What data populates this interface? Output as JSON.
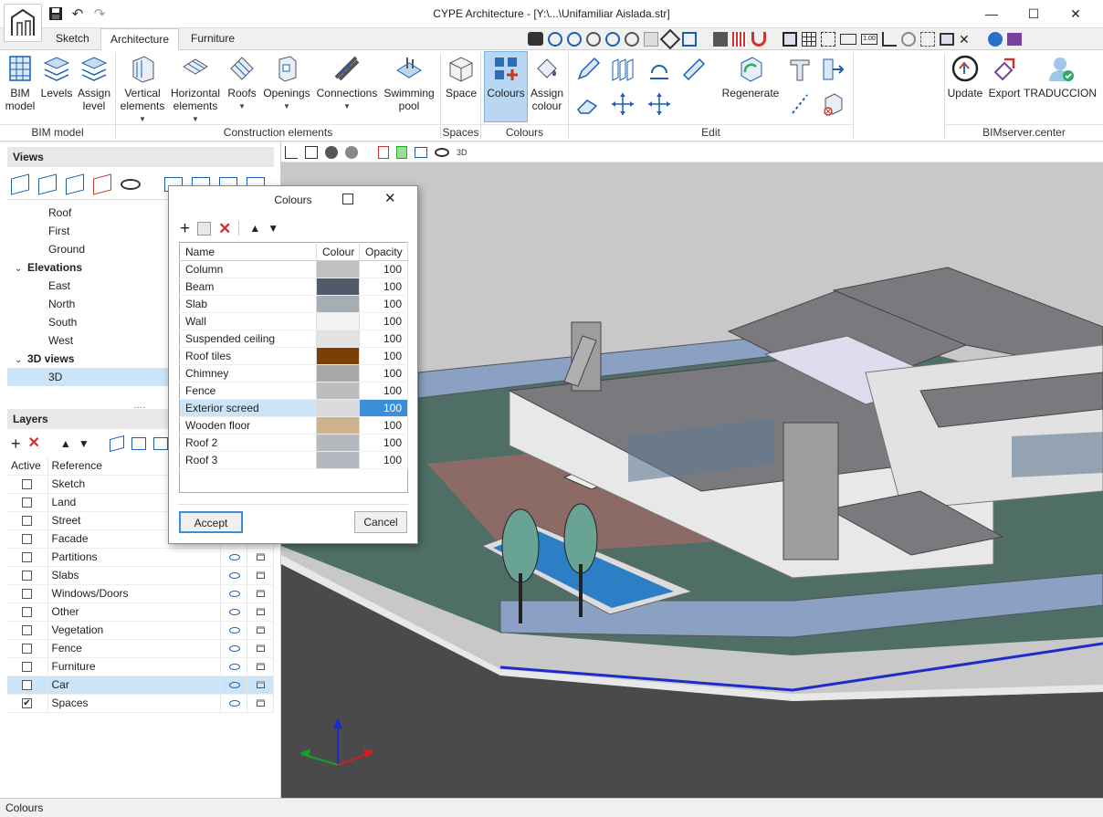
{
  "window": {
    "title": "CYPE Architecture - [Y:\\...\\Unifamiliar Aislada.str]",
    "minimize": "—",
    "maximize": "☐",
    "close": "✕"
  },
  "quick_access": {
    "save": "💾",
    "undo": "↶",
    "redo": "↷"
  },
  "tabs": [
    {
      "label": "Sketch"
    },
    {
      "label": "Architecture"
    },
    {
      "label": "Furniture"
    }
  ],
  "ribbon": {
    "bim_model": {
      "bim_model_label": "BIM model",
      "levels_label": "Levels",
      "assign_level_label": "Assign level",
      "group": "BIM model"
    },
    "construction": {
      "vertical_label": "Vertical elements",
      "horizontal_label": "Horizontal elements",
      "roofs_label": "Roofs",
      "openings_label": "Openings",
      "connections_label": "Connections",
      "pool_label": "Swimming pool",
      "group": "Construction elements"
    },
    "spaces": {
      "space_label": "Space",
      "group": "Spaces"
    },
    "colours": {
      "colours_label": "Colours",
      "assign_colour_label": "Assign colour",
      "group": "Colours"
    },
    "edit": {
      "regenerate_label": "Regenerate",
      "group": "Edit"
    },
    "bimserver": {
      "update_label": "Update",
      "export_label": "Export",
      "traduccion_label": "TRADUCCION",
      "group": "BIMserver.center"
    }
  },
  "views": {
    "header": "Views",
    "items": [
      {
        "label": "Roof",
        "indent": 2
      },
      {
        "label": "First",
        "indent": 2
      },
      {
        "label": "Ground",
        "indent": 2
      },
      {
        "label": "Elevations",
        "indent": 1,
        "expanded": true
      },
      {
        "label": "East",
        "indent": 2
      },
      {
        "label": "North",
        "indent": 2
      },
      {
        "label": "South",
        "indent": 2
      },
      {
        "label": "West",
        "indent": 2
      },
      {
        "label": "3D views",
        "indent": 1,
        "expanded": true
      },
      {
        "label": "3D",
        "indent": 2,
        "selected": true
      }
    ]
  },
  "layers": {
    "header": "Layers",
    "columns": [
      "Active",
      "Reference"
    ],
    "rows": [
      {
        "name": "Sketch",
        "active": false,
        "icons": false
      },
      {
        "name": "Land",
        "active": false,
        "icons": false
      },
      {
        "name": "Street",
        "active": false,
        "icons": false
      },
      {
        "name": "Facade",
        "active": false,
        "icons": false
      },
      {
        "name": "Partitions",
        "active": false,
        "icons": true
      },
      {
        "name": "Slabs",
        "active": false,
        "icons": true
      },
      {
        "name": "Windows/Doors",
        "active": false,
        "icons": true
      },
      {
        "name": "Other",
        "active": false,
        "icons": true
      },
      {
        "name": "Vegetation",
        "active": false,
        "icons": true
      },
      {
        "name": "Fence",
        "active": false,
        "icons": true
      },
      {
        "name": "Furniture",
        "active": false,
        "icons": true
      },
      {
        "name": "Car",
        "active": false,
        "icons": true,
        "selected": true
      },
      {
        "name": "Spaces",
        "active": true,
        "icons": true
      }
    ]
  },
  "dialog": {
    "title": "Colours",
    "columns": {
      "name": "Name",
      "colour": "Colour",
      "opacity": "Opacity"
    },
    "rows": [
      {
        "name": "Column",
        "colour": "#c0c0c0",
        "opacity": "100"
      },
      {
        "name": "Beam",
        "colour": "#4f5b6b",
        "opacity": "100"
      },
      {
        "name": "Slab",
        "colour": "#a7adb5",
        "opacity": "100"
      },
      {
        "name": "Wall",
        "colour": "#f2f2f2",
        "opacity": "100"
      },
      {
        "name": "Suspended ceiling",
        "colour": "#e2e2e2",
        "opacity": "100"
      },
      {
        "name": "Roof tiles",
        "colour": "#7b3f05",
        "opacity": "100"
      },
      {
        "name": "Chimney",
        "colour": "#a8a8a8",
        "opacity": "100"
      },
      {
        "name": "Fence",
        "colour": "#bdbdbd",
        "opacity": "100"
      },
      {
        "name": "Exterior screed",
        "colour": "#d9d9de",
        "opacity": "100",
        "selected": true
      },
      {
        "name": "Wooden floor",
        "colour": "#cdb28b",
        "opacity": "100"
      },
      {
        "name": "Roof 2",
        "colour": "#b4b9c0",
        "opacity": "100"
      },
      {
        "name": "Roof 3",
        "colour": "#b4b9c0",
        "opacity": "100"
      }
    ],
    "accept": "Accept",
    "cancel": "Cancel"
  },
  "statusbar": {
    "text": "Colours"
  }
}
